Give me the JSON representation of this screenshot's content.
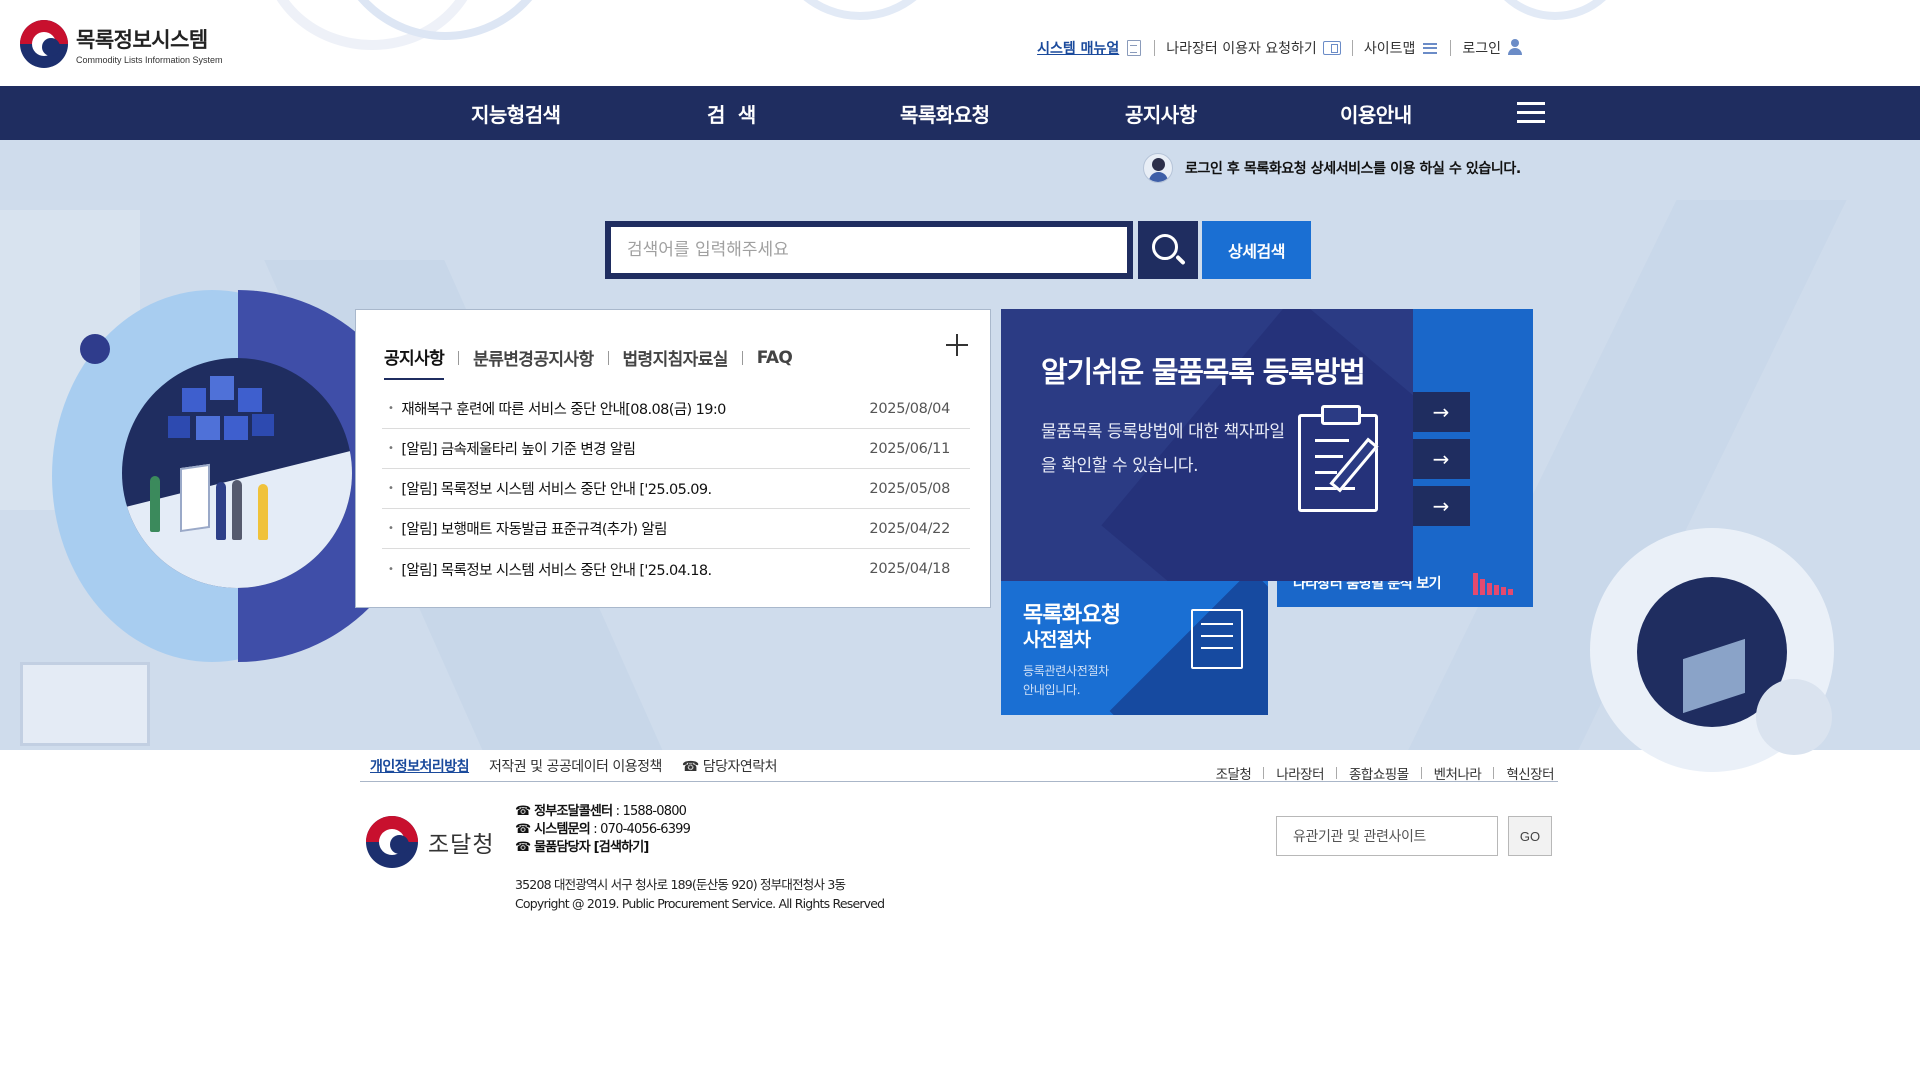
{
  "header": {
    "logo_title": "목록정보시스템",
    "logo_subtitle": "Commodity Lists Information System",
    "util_links": [
      {
        "label": "시스템 매뉴얼",
        "icon": "document-icon"
      },
      {
        "label": "나라장터 이용자 요청하기",
        "icon": "screen-icon"
      },
      {
        "label": "사이트맵",
        "icon": "menu-icon"
      },
      {
        "label": "로그인",
        "icon": "user-icon"
      }
    ]
  },
  "nav": {
    "items": [
      "지능형검색",
      "검  색",
      "목록화요청",
      "공지사항",
      "이용안내"
    ],
    "menu_icon": "hamburger-icon"
  },
  "hero": {
    "login_notice": "로그인 후 목록화요청 상세서비스를 이용 하실 수 있습니다.",
    "search_placeholder": "검색어를 입력해주세요",
    "detail_search_label": "상세검색"
  },
  "notices": {
    "tabs": [
      "공지사항",
      "분류변경공지사항",
      "법령지침자료실",
      "FAQ"
    ],
    "active_tab": "공지사항",
    "items": [
      {
        "title": "재해복구 훈련에 따른 서비스 중단 안내[08.08(금) 19:0",
        "date": "2025/08/04"
      },
      {
        "title": "[알림] 금속제울타리 높이 기준 변경 알림",
        "date": "2025/06/11"
      },
      {
        "title": "[알림] 목록정보 시스템 서비스 중단 안내 ['25.05.09.",
        "date": "2025/05/08"
      },
      {
        "title": "[알림] 보행매트 자동발급 표준규격(추가) 알림",
        "date": "2025/04/22"
      },
      {
        "title": "[알림] 목록정보 시스템 서비스 중단 안내 ['25.04.18.",
        "date": "2025/04/18"
      }
    ]
  },
  "banners": {
    "main_title": "알기쉬운 물품목록 등록방법",
    "main_desc": "물품목록 등록방법에 대한 책자파일을 확인할 수 있습니다.",
    "arrow": "→",
    "back_label": "나라장터 품명별 분석 보기",
    "pre_title": "목록화요청",
    "pre_subtitle": "사전절차",
    "pre_desc_1": "등록관련사전절차",
    "pre_desc_2": "안내입니다."
  },
  "footer": {
    "links_left": [
      "개인정보처리방침",
      "저작권 및 공공데이터 이용정책",
      "☎ 담당자연락처"
    ],
    "links_right": [
      "조달청",
      "나라장터",
      "종합쇼핑몰",
      "벤처나라",
      "혁신장터"
    ],
    "org_name": "조달청",
    "contact_1_label": "☎ 정부조달콜센터",
    "contact_1_value": " : 1588-0800",
    "contact_2_label": "☎ 시스템문의",
    "contact_2_value": " : 070-4056-6399",
    "contact_3_label": "☎ 물품담당자 [검색하기]",
    "address": "35208 대전광역시 서구 청사로 189(둔산동 920) 정부대전청사 3동",
    "copyright": "Copyright @ 2019. Public Procurement Service. All Rights Reserved",
    "related_select": "유관기관 및 관련사이트",
    "go_label": "GO"
  },
  "colors": {
    "navy": "#1f2d60",
    "blue": "#1a6fd3",
    "hero_bg": "#cfdcec"
  }
}
